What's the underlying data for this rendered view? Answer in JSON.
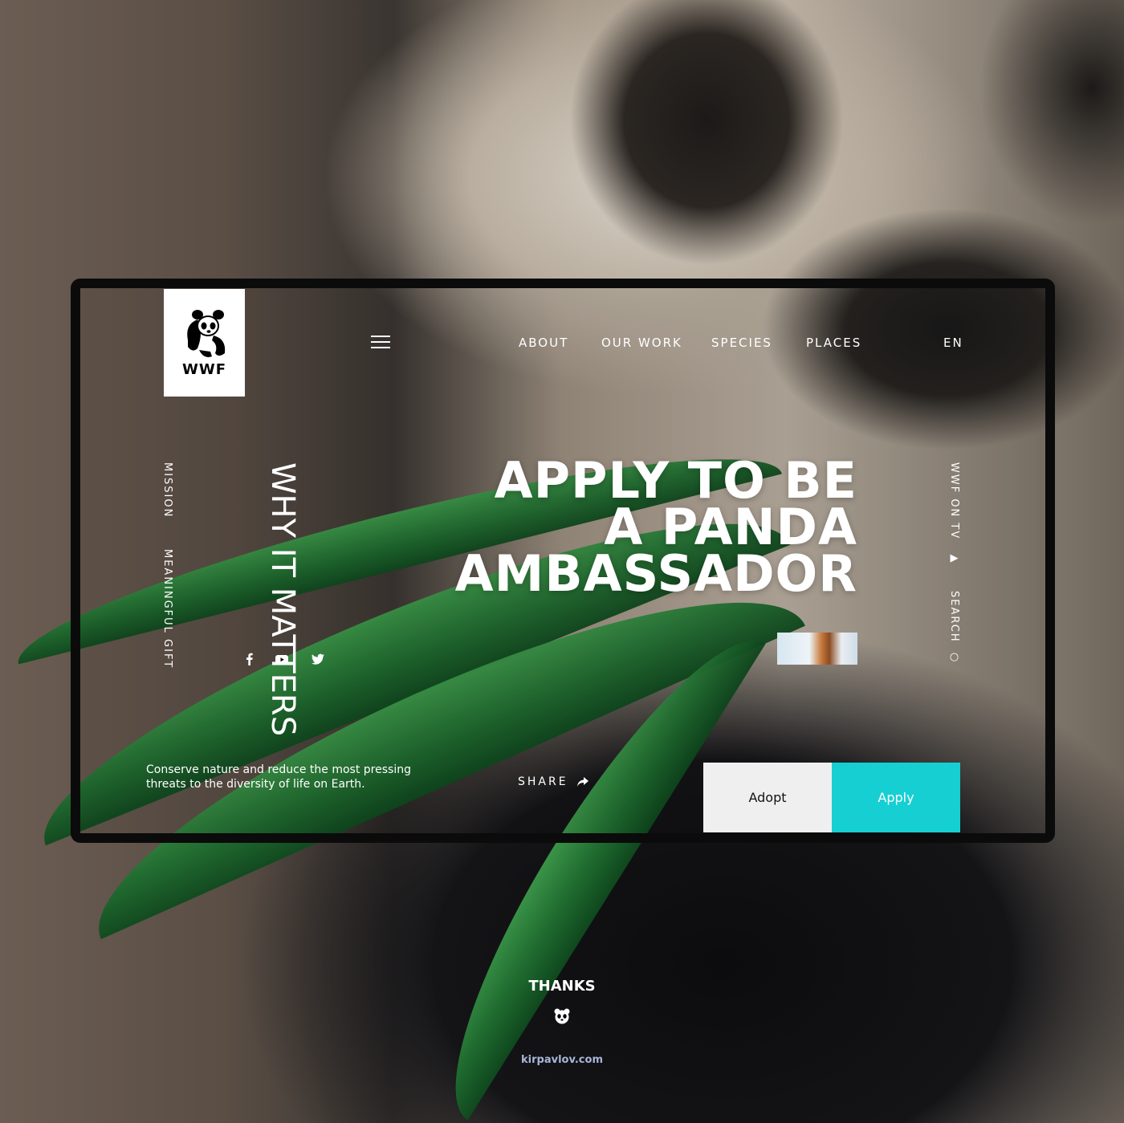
{
  "brand": {
    "logo_text": "WWF"
  },
  "nav": {
    "menu_icon": "hamburger-icon",
    "items": [
      "ABOUT",
      "OUR WORK",
      "SPECIES",
      "PLACES"
    ],
    "language": "EN"
  },
  "side_left": {
    "mission": "MISSION",
    "gift": "MEANINGFUL GIFT"
  },
  "feature": {
    "why_title": "WHY IT MATTERS"
  },
  "hero": {
    "line1": "APPLY TO BE",
    "line2": "A PANDA",
    "line3": "AMBASSADOR"
  },
  "side_right": {
    "tv": "WWF ON TV",
    "search": "SEARCH"
  },
  "social": [
    "facebook-icon",
    "youtube-icon",
    "twitter-icon"
  ],
  "mission_text": "Conserve nature and reduce the most pressing threats to the diversity of life on Earth.",
  "share_label": "SHARE",
  "buttons": {
    "adopt": "Adopt",
    "apply": "Apply"
  },
  "footer": {
    "thanks": "THANKS",
    "credit": "kirpavlov.com"
  },
  "colors": {
    "accent": "#16cfd3",
    "frame": "#0b0b0b",
    "adopt_bg": "#efefef"
  }
}
